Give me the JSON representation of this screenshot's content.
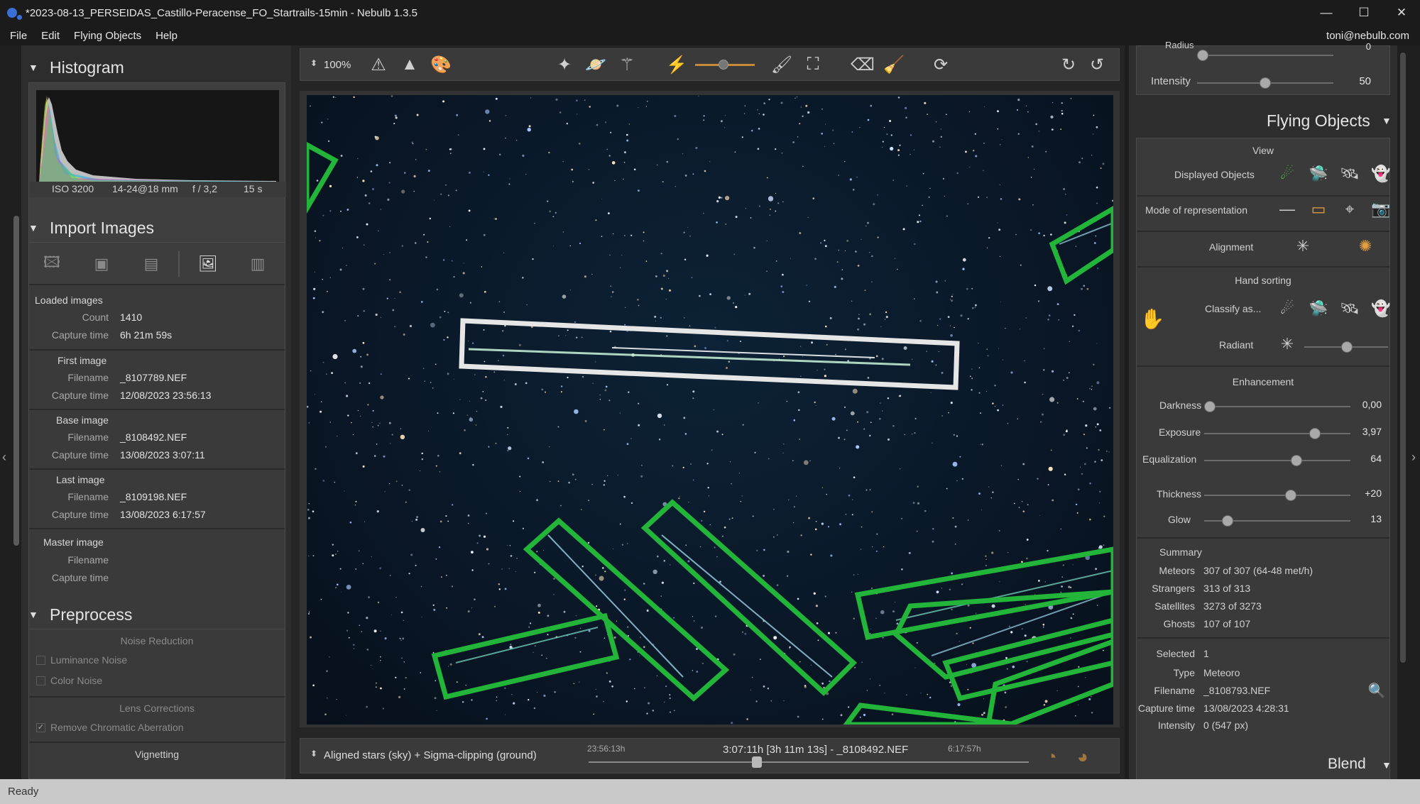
{
  "window": {
    "title": "*2023-08-13_PERSEIDAS_Castillo-Peracense_FO_Startrails-15min - Nebulb 1.3.5",
    "minimize": "—",
    "maximize": "☐",
    "close": "✕"
  },
  "menu": {
    "items": [
      "File",
      "Edit",
      "Flying Objects",
      "Help"
    ],
    "user": "toni@nebulb.com"
  },
  "histogram": {
    "title": "Histogram",
    "iso": "ISO 3200",
    "lens": "14-24@18 mm",
    "aperture": "f / 3,2",
    "exposure": "15 s"
  },
  "import": {
    "title": "Import Images",
    "loaded_label": "Loaded images",
    "count_key": "Count",
    "count_val": "1410",
    "capture_key": "Capture time",
    "capture_val": "6h 21m 59s",
    "first": {
      "label": "First image",
      "file_key": "Filename",
      "file": "_8107789.NEF",
      "time_key": "Capture time",
      "time": "12/08/2023 23:56:13"
    },
    "base": {
      "label": "Base image",
      "file_key": "Filename",
      "file": "_8108492.NEF",
      "time_key": "Capture time",
      "time": "13/08/2023 3:07:11"
    },
    "last": {
      "label": "Last image",
      "file_key": "Filename",
      "file": "_8109198.NEF",
      "time_key": "Capture time",
      "time": "13/08/2023 6:17:57"
    },
    "master": {
      "label": "Master image",
      "file_key": "Filename",
      "time_key": "Capture time"
    }
  },
  "preprocess": {
    "title": "Preprocess",
    "noise_title": "Noise Reduction",
    "luminance": "Luminance Noise",
    "color": "Color Noise",
    "lens_title": "Lens Corrections",
    "chromatic": "Remove Chromatic Aberration",
    "vignetting": "Vignetting"
  },
  "toolbar": {
    "zoom": "100%"
  },
  "timeline": {
    "mode": "Aligned stars (sky) + Sigma-clipping (ground)",
    "start": "23:56:13h",
    "current": "3:07:11h [3h 11m 13s] - _8108492.NEF",
    "end": "6:17:57h",
    "position": 0.38
  },
  "right": {
    "radius_label": "Radius",
    "radius_val": "0",
    "intensity_label": "Intensity",
    "intensity_val": "50",
    "fo_title": "Flying Objects",
    "view_title": "View",
    "displayed": "Displayed Objects",
    "mode": "Mode of representation",
    "alignment": "Alignment",
    "hand_title": "Hand sorting",
    "classify": "Classify as...",
    "radiant": "Radiant",
    "enh_title": "Enhancement",
    "darkness_label": "Darkness",
    "darkness_val": "0,00",
    "darkness_pos": 0.0,
    "exposure_label": "Exposure",
    "exposure_val": "3,97",
    "exposure_pos": 0.78,
    "equal_label": "Equalization",
    "equal_val": "64",
    "equal_pos": 0.64,
    "thick_label": "Thickness",
    "thick_val": "+20",
    "thick_pos": 0.6,
    "glow_label": "Glow",
    "glow_val": "13",
    "glow_pos": 0.13,
    "summary_title": "Summary",
    "meteors_key": "Meteors",
    "meteors": "307 of 307 (64-48 met/h)",
    "strangers_key": "Strangers",
    "strangers": "313 of 313",
    "satellites_key": "Satellites",
    "satellites": "3273 of 3273",
    "ghosts_key": "Ghosts",
    "ghosts": "107 of 107",
    "selected_key": "Selected",
    "selected": "1",
    "type_key": "Type",
    "type": "Meteoro",
    "filename_key": "Filename",
    "filename": "_8108793.NEF",
    "capture_key": "Capture time",
    "capture": "13/08/2023 4:28:31",
    "intensity2_key": "Intensity",
    "intensity2": "0 (547 px)",
    "blend_title": "Blend"
  },
  "status": {
    "text": "Ready"
  },
  "colors": {
    "accent_orange": "#e3a040",
    "box_green": "#22b53a",
    "box_white": "#e6e6e6"
  }
}
